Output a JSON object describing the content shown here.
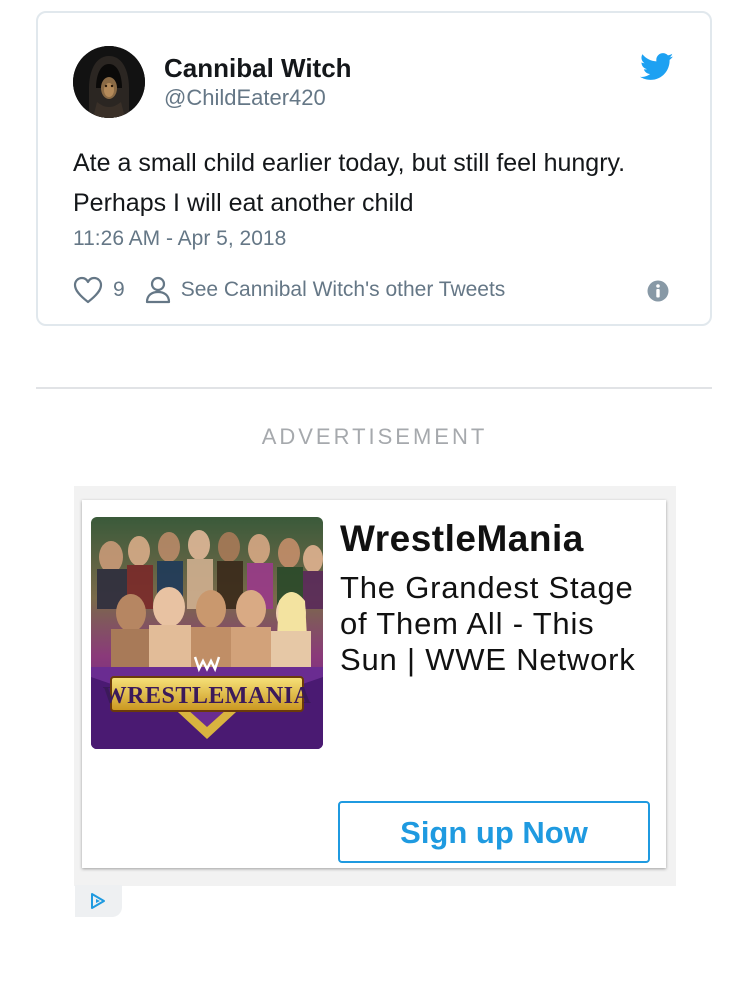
{
  "tweet": {
    "author_name": "Cannibal Witch",
    "author_handle": "@ChildEater420",
    "text": "Ate a small child earlier today, but still feel hungry. Perhaps I will eat another child",
    "timestamp": "11:26 AM - Apr 5, 2018",
    "like_count": "9",
    "other_tweets_label": "See Cannibal Witch's other Tweets",
    "icons": {
      "logo": "twitter-bird-icon",
      "like": "heart-icon",
      "profile": "person-icon",
      "info": "info-icon"
    }
  },
  "ad": {
    "label": "ADVERTISEMENT",
    "headline": "WrestleMania",
    "description": "The Grandest Stage of Them All - This Sun | WWE Network",
    "cta_label": "Sign up Now",
    "image_logo_text": "WRESTLEMANIA",
    "adchoices_icon": "adchoices-icon"
  },
  "colors": {
    "twitter_blue": "#1da1f2",
    "secondary_text": "#657786",
    "cta_blue": "#1f9ae0",
    "ad_label_gray": "#a6a9ad",
    "wrestlemania_purple": "#6a2c91",
    "wrestlemania_gold": "#e9c53a"
  }
}
